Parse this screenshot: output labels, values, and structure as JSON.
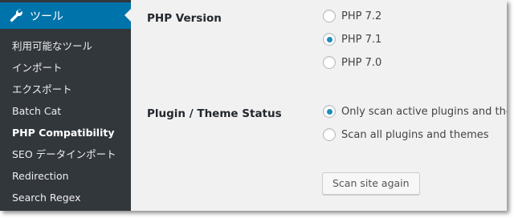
{
  "sidebar": {
    "menu_title": "ツール",
    "menu_icon": "wrench-icon",
    "items": [
      {
        "label": "利用可能なツール"
      },
      {
        "label": "インポート"
      },
      {
        "label": "エクスポート"
      },
      {
        "label": "Batch Cat"
      },
      {
        "label": "PHP Compatibility",
        "current": true
      },
      {
        "label": "SEO データインポート"
      },
      {
        "label": "Redirection"
      },
      {
        "label": "Search Regex"
      }
    ]
  },
  "settings": {
    "php_version": {
      "label": "PHP Version",
      "options": [
        {
          "label": "PHP 7.2",
          "checked": false
        },
        {
          "label": "PHP 7.1",
          "checked": true
        },
        {
          "label": "PHP 7.0",
          "checked": false
        }
      ]
    },
    "plugin_theme_status": {
      "label": "Plugin / Theme Status",
      "options": [
        {
          "label": "Only scan active plugins and themes",
          "checked": true
        },
        {
          "label": "Scan all plugins and themes",
          "checked": false
        }
      ]
    },
    "scan_button_label": "Scan site again"
  },
  "colors": {
    "sidebar_bg": "#32373c",
    "active_menu_bg": "#0073aa",
    "radio_dot": "#1e8cbe",
    "content_bg": "#f1f1f1"
  }
}
